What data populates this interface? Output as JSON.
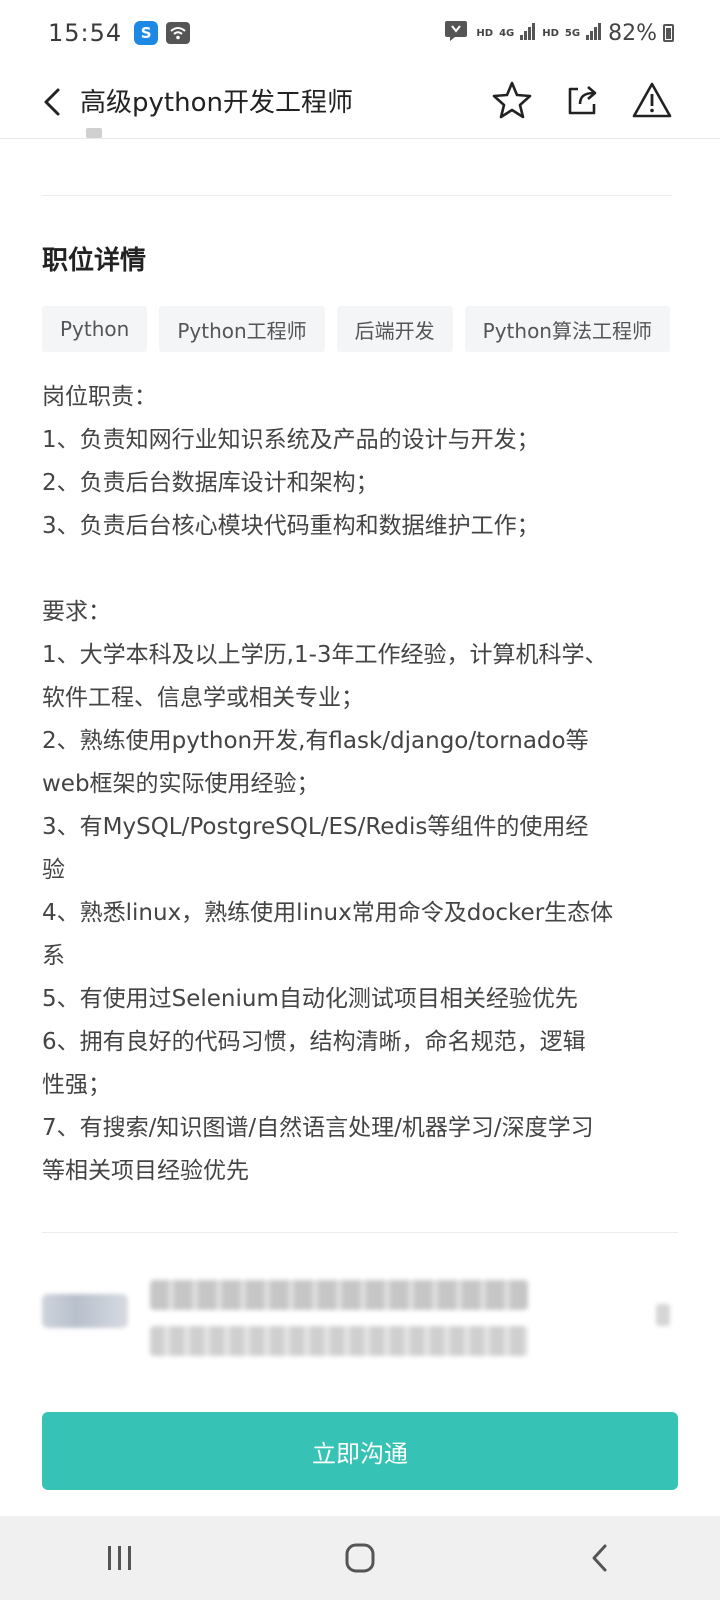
{
  "status_bar": {
    "time": "15:54",
    "app_icon_letter": "S",
    "network_labels": [
      "HD",
      "4G",
      "HD",
      "5G"
    ],
    "battery": "82%"
  },
  "app_bar": {
    "title": "高级python开发工程师",
    "icons": [
      "back-chevron-icon",
      "star-icon",
      "share-icon",
      "warning-icon"
    ]
  },
  "section": {
    "title": "职位详情"
  },
  "tags": [
    "Python",
    "Python工程师",
    "后端开发",
    "Python算法工程师"
  ],
  "description": {
    "lines": [
      "岗位职责：",
      "1、负责知网行业知识系统及产品的设计与开发；",
      "2、负责后台数据库设计和架构；",
      "3、负责后台核心模块代码重构和数据维护工作；",
      "",
      "要求：",
      "1、大学本科及以上学历,1-3年工作经验，计算机科学、",
      "软件工程、信息学或相关专业；",
      "2、熟练使用python开发,有flask/django/tornado等",
      "web框架的实际使用经验；",
      "3、有MySQL/PostgreSQL/ES/Redis等组件的使用经",
      "验",
      "4、熟悉linux，熟练使用linux常用命令及docker生态体",
      "系",
      "5、有使用过Selenium自动化测试项目相关经验优先",
      "6、拥有良好的代码习惯，结构清晰，命名规范，逻辑",
      "性强；",
      "7、有搜索/知识图谱/自然语言处理/机器学习/深度学习",
      "等相关项目经验优先"
    ]
  },
  "cta": {
    "label": "立即沟通",
    "color": "#36c2b4"
  },
  "nav_bar": {
    "icons": [
      "recent-apps-icon",
      "home-icon",
      "back-icon"
    ]
  }
}
